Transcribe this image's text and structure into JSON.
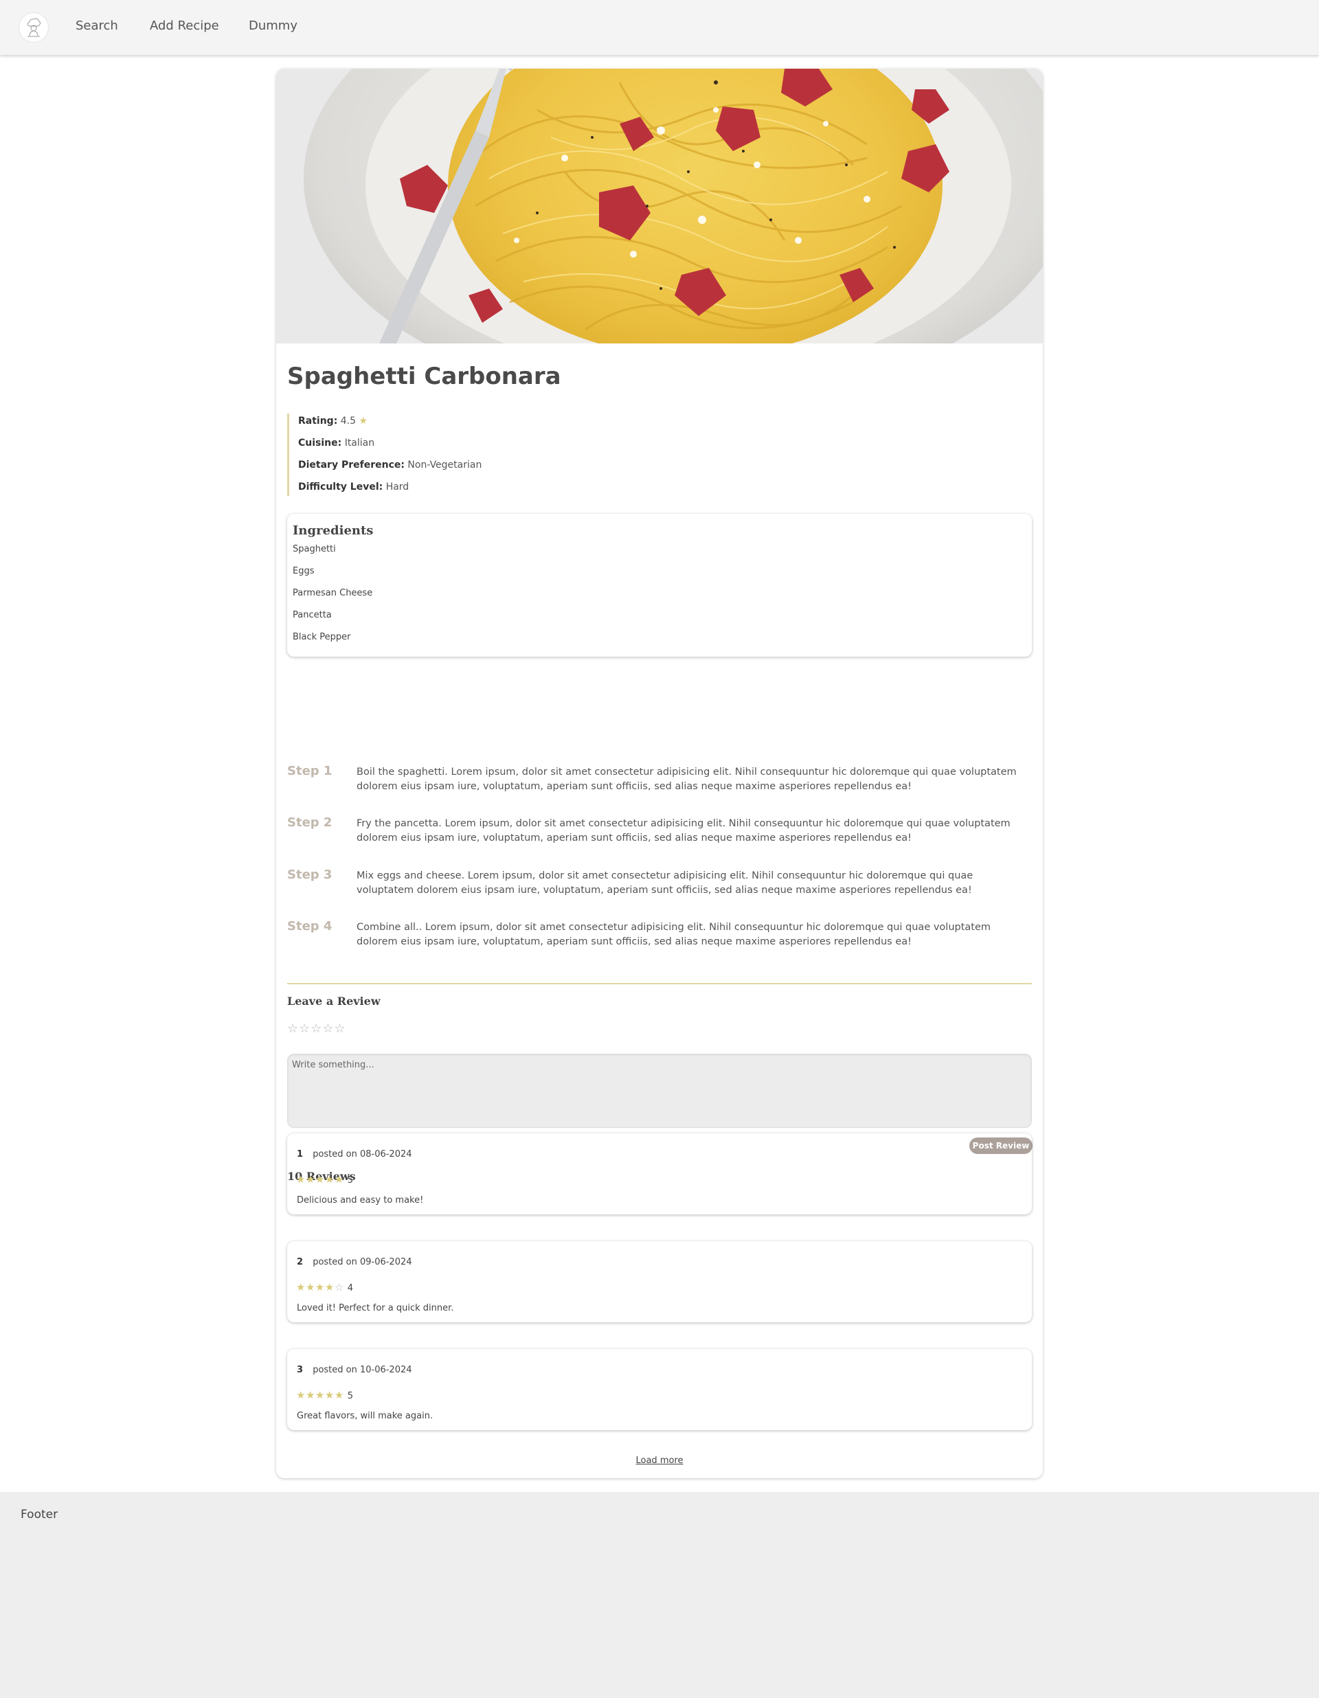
{
  "nav": {
    "logo_icon": "chef-logo-icon",
    "links": [
      "Search",
      "Add Recipe",
      "Dummy"
    ]
  },
  "recipe": {
    "image_icon": "spaghetti-carbonara-photo",
    "title": "Spaghetti Carbonara",
    "details": [
      {
        "label": "Rating:",
        "value": "4.5",
        "icon": "star-icon"
      },
      {
        "label": "Cuisine:",
        "value": "Italian"
      },
      {
        "label": "Dietary Preference:",
        "value": "Non-Vegetarian"
      },
      {
        "label": "Difficulty Level:",
        "value": "Hard"
      }
    ],
    "ingredients_title": "Ingredients",
    "ingredients": [
      "Spaghetti",
      "Eggs",
      "Parmesan Cheese",
      "Pancetta",
      "Black Pepper"
    ],
    "steps": [
      {
        "label": "Step 1",
        "text": "Boil the spaghetti. Lorem ipsum, dolor sit amet consectetur adipisicing elit. Nihil consequuntur hic doloremque qui quae voluptatem dolorem eius ipsam iure, voluptatum, aperiam sunt officiis, sed alias neque maxime asperiores repellendus ea!"
      },
      {
        "label": "Step 2",
        "text": "Fry the pancetta. Lorem ipsum, dolor sit amet consectetur adipisicing elit. Nihil consequuntur hic doloremque qui quae voluptatem dolorem eius ipsam iure, voluptatum, aperiam sunt officiis, sed alias neque maxime asperiores repellendus ea!"
      },
      {
        "label": "Step 3",
        "text": "Mix eggs and cheese. Lorem ipsum, dolor sit amet consectetur adipisicing elit. Nihil consequuntur hic doloremque qui quae voluptatem dolorem eius ipsam iure, voluptatum, aperiam sunt officiis, sed alias neque maxime asperiores repellendus ea!"
      },
      {
        "label": "Step 4",
        "text": "Combine all.. Lorem ipsum, dolor sit amet consectetur adipisicing elit. Nihil consequuntur hic doloremque qui quae voluptatem dolorem eius ipsam iure, voluptatum, aperiam sunt officiis, sed alias neque maxime asperiores repellendus ea!"
      }
    ]
  },
  "review_form": {
    "title": "Leave a Review",
    "stars": "☆☆☆☆☆",
    "placeholder": "Write something...",
    "submit_label": "Post Review"
  },
  "reviews": {
    "count_label": "10 Reviews",
    "items": [
      {
        "id": "1",
        "posted": "posted on 08-06-2024",
        "rating": 5,
        "rating_text": "5",
        "comment": "Delicious and easy to make!"
      },
      {
        "id": "2",
        "posted": "posted on 09-06-2024",
        "rating": 4,
        "rating_text": "4",
        "comment": "Loved it! Perfect for a quick dinner."
      },
      {
        "id": "3",
        "posted": "posted on 10-06-2024",
        "rating": 5,
        "rating_text": "5",
        "comment": "Great flavors, will make again."
      }
    ],
    "load_more": "Load more"
  },
  "footer": {
    "text": "Footer"
  },
  "colors": {
    "accent_gold": "#d9cb79",
    "divider_gold": "#e2d6a4",
    "button_taupe": "#aba09a",
    "step_label": "#c2b8ad",
    "footer_bg": "#eeeeee",
    "navbar_bg": "#f4f4f4"
  }
}
